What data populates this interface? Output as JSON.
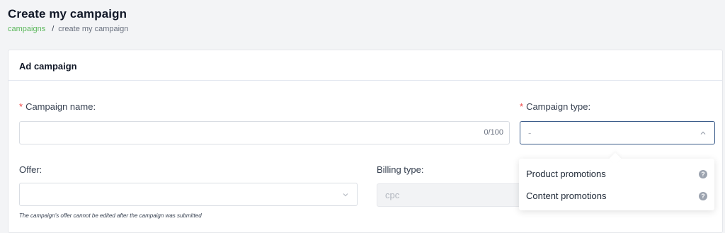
{
  "header": {
    "title": "Create my campaign",
    "breadcrumb": {
      "link": "campaigns",
      "separator": "/",
      "current": "create my campaign"
    }
  },
  "card": {
    "title": "Ad campaign",
    "campaign_name": {
      "required_mark": "*",
      "label": "Campaign name:",
      "value": "",
      "counter": "0/100"
    },
    "campaign_type": {
      "required_mark": "*",
      "label": "Campaign type:",
      "value": "-",
      "icon": "chevron-up-icon"
    },
    "offer": {
      "label": "Offer:",
      "value": "",
      "icon": "chevron-down-icon",
      "help": "The campaign's offer cannot be edited after the campaign was submitted"
    },
    "billing_type": {
      "label": "Billing type:",
      "value": "cpc"
    }
  },
  "dropdown": {
    "options": [
      {
        "label": "Product promotions",
        "icon": "question-mark-icon",
        "icon_glyph": "?"
      },
      {
        "label": "Content promotions",
        "icon": "question-mark-icon",
        "icon_glyph": "?"
      }
    ]
  },
  "colors": {
    "accent_link": "#5cb85c",
    "required": "#ef4444",
    "focus_border": "#3b5c8a"
  }
}
